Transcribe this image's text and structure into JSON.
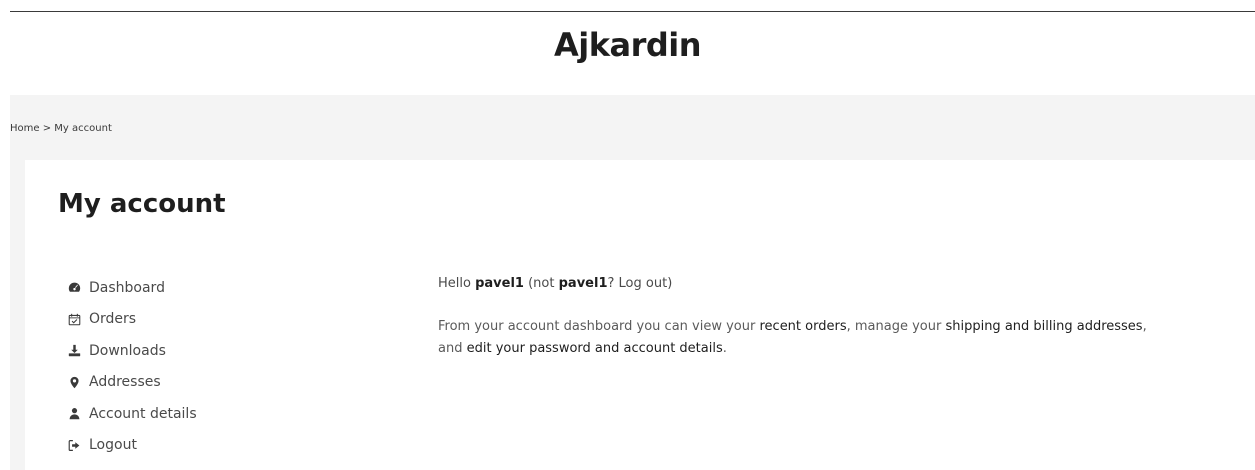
{
  "site": {
    "title": "Ajkardin"
  },
  "breadcrumb": {
    "home": "Home",
    "separator": ">",
    "current": "My account"
  },
  "page": {
    "title": "My account"
  },
  "nav": {
    "items": [
      {
        "label": "Dashboard",
        "icon": "dashboard-icon"
      },
      {
        "label": "Orders",
        "icon": "calendar-check-icon"
      },
      {
        "label": "Downloads",
        "icon": "download-icon"
      },
      {
        "label": "Addresses",
        "icon": "map-marker-icon"
      },
      {
        "label": "Account details",
        "icon": "user-icon"
      },
      {
        "label": "Logout",
        "icon": "sign-out-icon"
      }
    ]
  },
  "welcome": {
    "hello": "Hello",
    "username": "pavel1",
    "not_prefix": "(not",
    "username_again": "pavel1",
    "question": "?",
    "logout_link": "Log out",
    "close_paren": ")"
  },
  "description": {
    "part1": "From your account dashboard you can view your",
    "recent_orders_link": "recent orders",
    "part2": ", manage your",
    "addresses_link": "shipping and billing addresses",
    "part3": ", and",
    "edit_link": "edit your password and account details",
    "part4": "."
  },
  "colors": {
    "title": "#1e1e1e",
    "text": "#4a4a4a",
    "band": "#f4f4f4"
  }
}
